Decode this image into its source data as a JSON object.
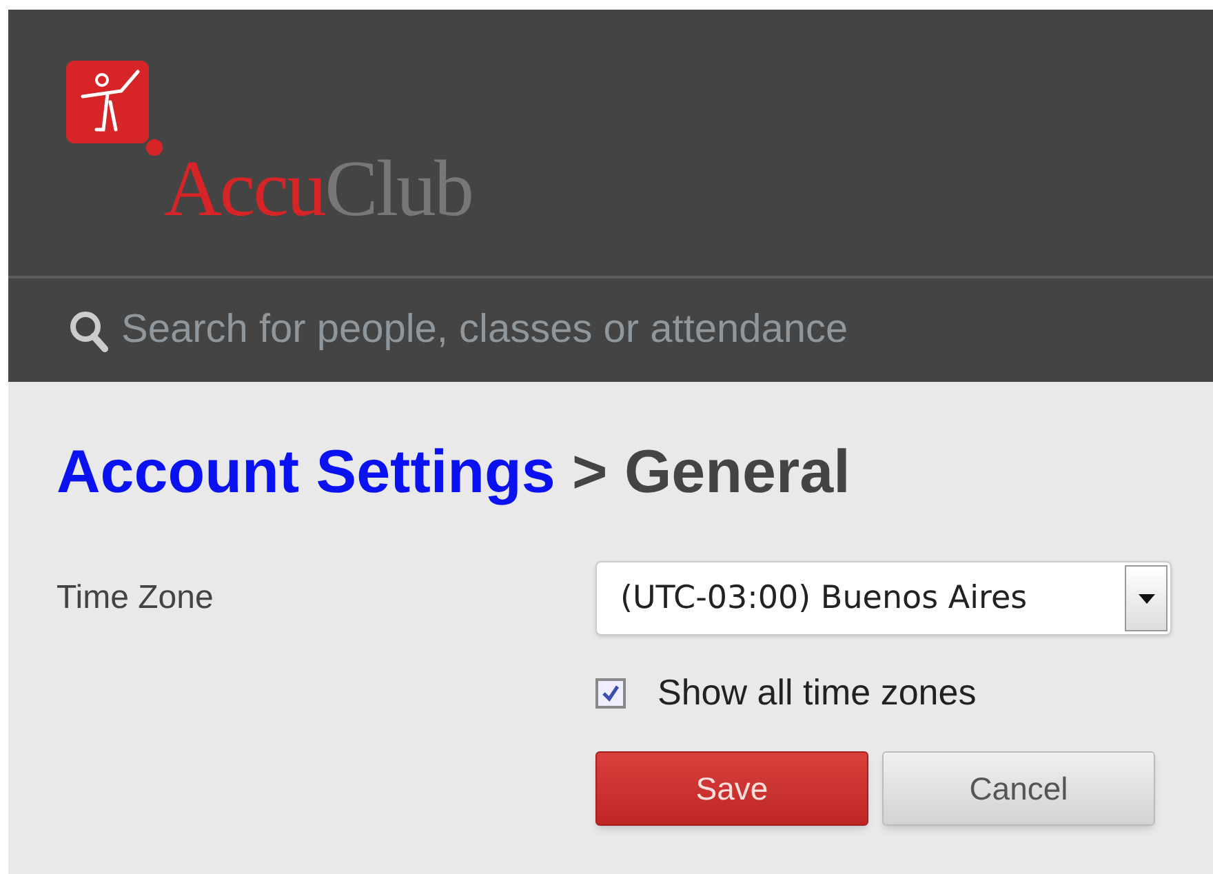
{
  "logo": {
    "parts": [
      "Accu",
      "Club"
    ]
  },
  "search": {
    "placeholder": "Search for people, classes or attendance"
  },
  "breadcrumb": {
    "link": "Account Settings",
    "separator": ">",
    "current": "General"
  },
  "form": {
    "time_zone": {
      "label": "Time Zone",
      "value": "(UTC-03:00) Buenos Aires"
    },
    "show_all": {
      "label": "Show all time zones",
      "checked": true
    }
  },
  "buttons": [
    {
      "label": "Save",
      "kind": "primary"
    },
    {
      "label": "Cancel",
      "kind": "secondary"
    }
  ]
}
